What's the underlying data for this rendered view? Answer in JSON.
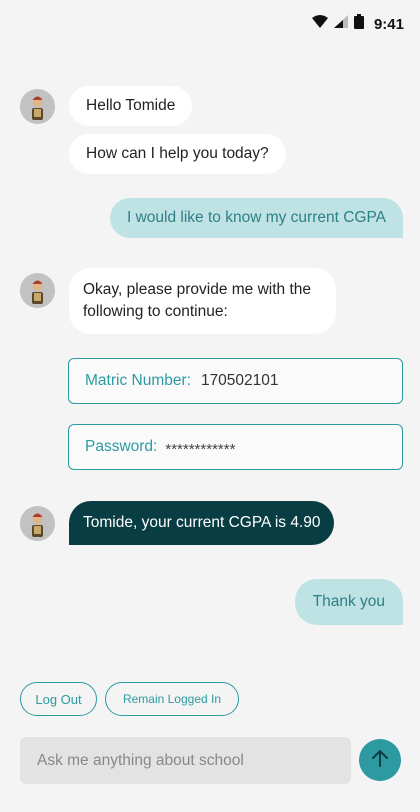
{
  "status_bar": {
    "time": "9:41"
  },
  "messages": {
    "bot_greeting": "Hello Tomide",
    "bot_help": "How can I help you today?",
    "user_request": "I would like to know my current CGPA",
    "bot_prompt": "Okay, please provide me with the following to continue:",
    "bot_result": "Tomide, your current CGPA is 4.90",
    "user_thanks": "Thank you"
  },
  "form": {
    "matric_label": "Matric Number:",
    "matric_value": "170502101",
    "password_label": "Password:",
    "password_value": "************"
  },
  "quick_replies": {
    "logout": "Log Out",
    "remain": "Remain Logged In"
  },
  "composer": {
    "placeholder": "Ask me anything about school"
  },
  "colors": {
    "accent": "#2d9aa2",
    "user_bubble": "#bfe2e4",
    "dark_bubble": "#083d44",
    "background": "#f4f4f4"
  }
}
